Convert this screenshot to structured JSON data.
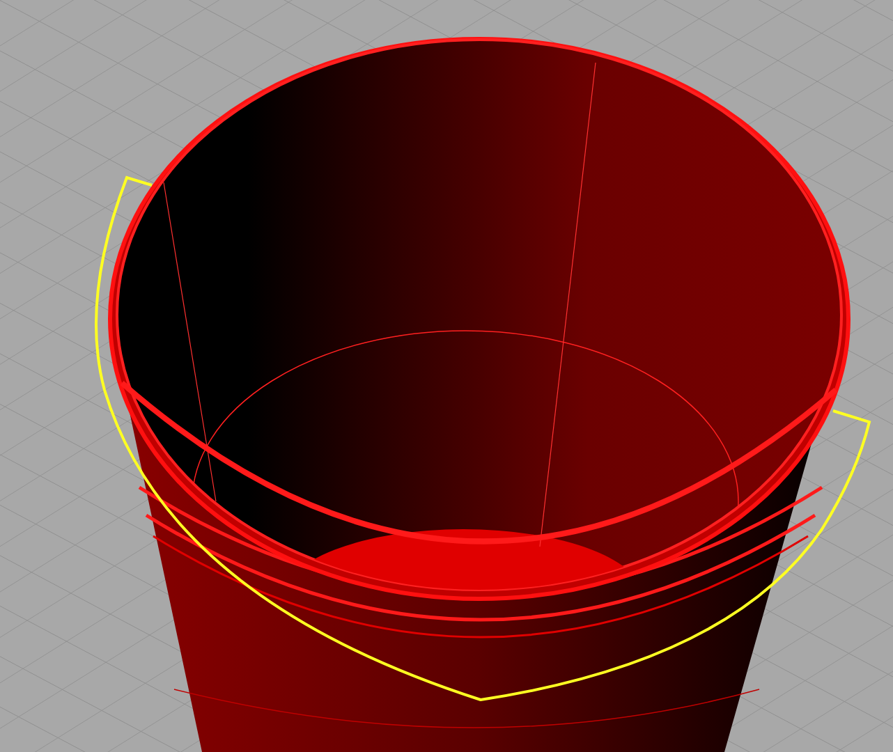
{
  "viewport": {
    "grid": true
  },
  "objects": [
    {
      "kind": "bucket",
      "selected": false
    },
    {
      "kind": "handle",
      "selected": true
    }
  ]
}
